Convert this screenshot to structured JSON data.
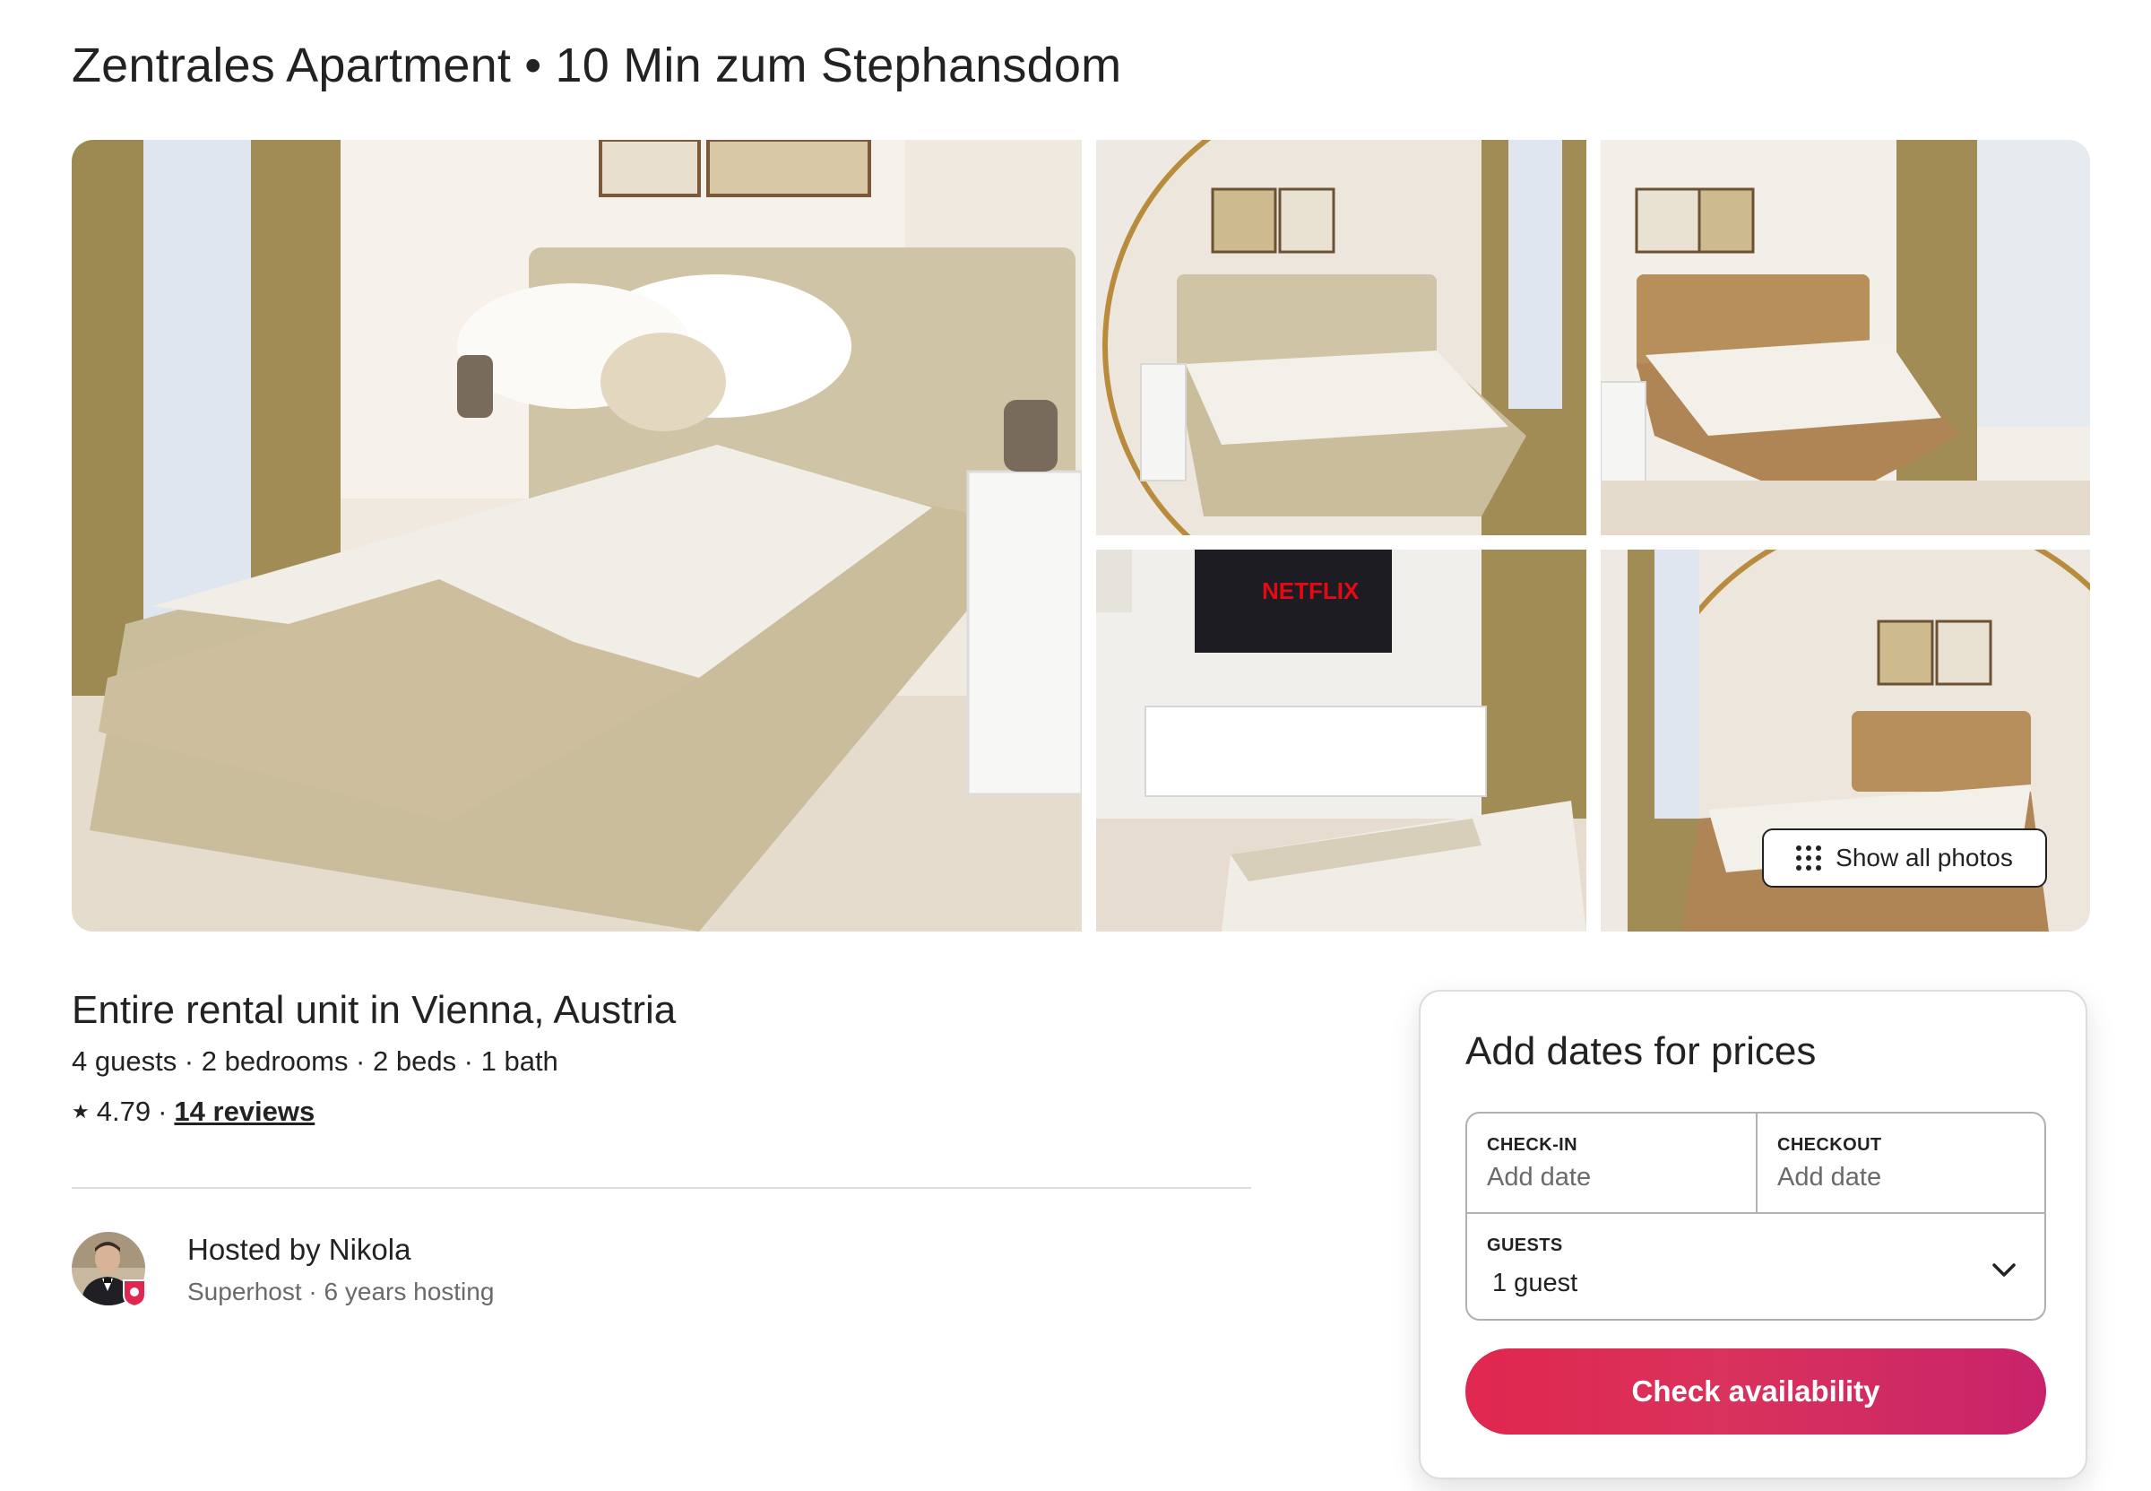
{
  "listing": {
    "title": "Zentrales Apartment • 10 Min zum Stephansdom",
    "type": "Entire rental unit in Vienna, Austria",
    "details": "4 guests · 2 bedrooms · 2 beds · 1 bath",
    "rating": "4.79",
    "rating_separator": "·",
    "reviews": "14 reviews"
  },
  "gallery": {
    "show_all_label": "Show all photos",
    "tv_logo": "NETFLIX"
  },
  "host": {
    "name": "Hosted by Nikola",
    "subtitle": "Superhost · 6 years hosting"
  },
  "booking": {
    "title": "Add dates for prices",
    "checkin_label": "CHECK-IN",
    "checkin_value": "Add date",
    "checkout_label": "CHECKOUT",
    "checkout_value": "Add date",
    "guests_label": "GUESTS",
    "guests_value": "1 guest",
    "cta": "Check availability"
  },
  "colors": {
    "brand": "#e0274f",
    "text": "#222222",
    "muted": "#6a6a6a",
    "border": "#b0b0b0"
  },
  "icons": [
    "star-icon",
    "grid-dots-icon",
    "chevron-down-icon",
    "superhost-badge-icon"
  ]
}
